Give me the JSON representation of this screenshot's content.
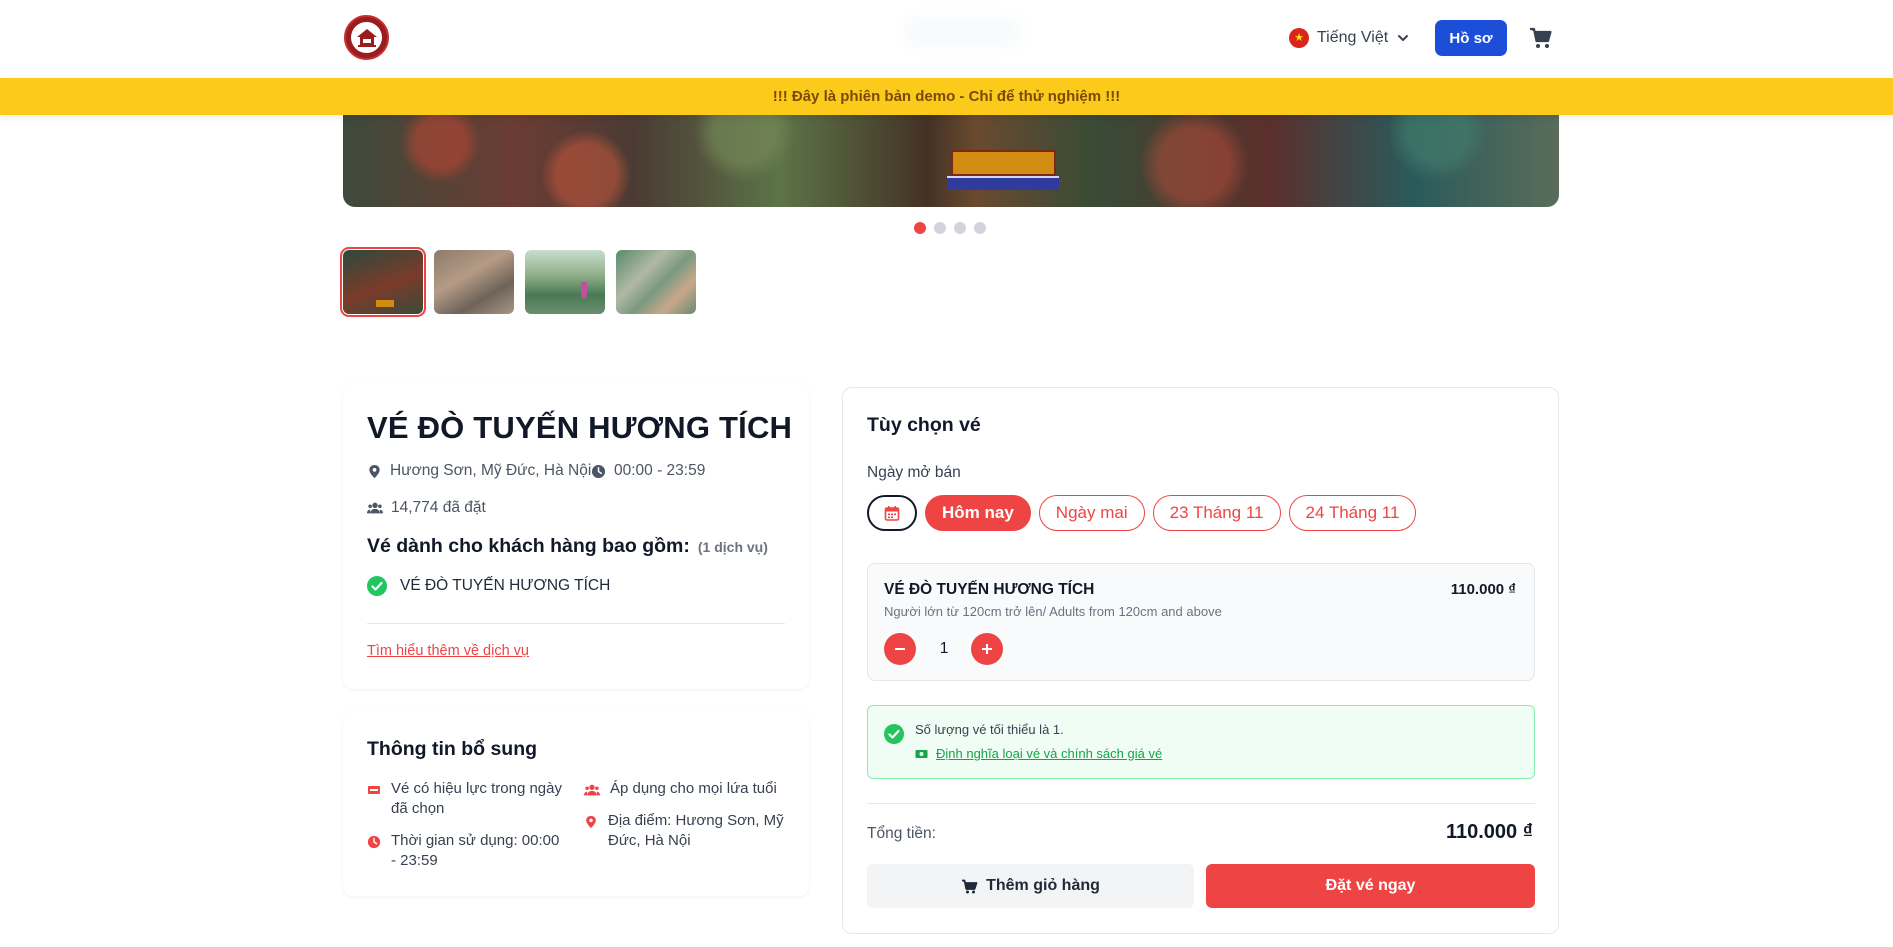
{
  "header": {
    "language_label": "Tiếng Việt",
    "profile_label": "Hồ sơ"
  },
  "banner": {
    "text": "!!! Đây là phiên bản demo - Chỉ để thử nghiệm !!!"
  },
  "carousel": {
    "slide_count": 4,
    "active_index": 0,
    "thumbnail_count": 4
  },
  "product": {
    "title": "VÉ ĐÒ TUYẾN HƯƠNG TÍCH",
    "location": "Hương Sơn, Mỹ Đức, Hà Nội",
    "hours": "00:00 - 23:59",
    "booked": "14,774 đã đặt",
    "includes_heading": "Vé dành cho khách hàng bao gồm:",
    "includes_count": "(1 dịch vụ)",
    "services": [
      "VÉ ĐÒ TUYẾN HƯƠNG TÍCH"
    ],
    "learn_more": "Tìm hiểu thêm về dịch vụ"
  },
  "extra_info": {
    "title": "Thông tin bổ sung",
    "validity": "Vé có hiệu lực trong ngày đã chọn",
    "ages": "Áp dụng cho mọi lứa tuổi",
    "usage_time": "Thời gian sử dụng: 00:00 - 23:59",
    "place": "Địa điểm: Hương Sơn, Mỹ Đức, Hà Nội"
  },
  "options": {
    "title": "Tùy chọn vé",
    "date_label": "Ngày mở bán",
    "dates": [
      "Hôm nay",
      "Ngày mai",
      "23 Tháng 11",
      "24 Tháng 11"
    ],
    "selected_date": "Hôm nay",
    "ticket": {
      "name": "VÉ ĐÒ TUYẾN HƯƠNG TÍCH",
      "price": "110.000 ₫",
      "description": "Người lớn từ 120cm trở lên/ Adults from 120cm and above",
      "quantity": "1"
    },
    "notice": "Số lượng vé tối thiểu là 1.",
    "policy_link": "Định nghĩa loại vé và chính sách giá vé",
    "total_label": "Tổng tiền:",
    "total_value": "110.000 ₫",
    "add_to_cart": "Thêm giỏ hàng",
    "book_now": "Đặt vé ngay"
  },
  "colors": {
    "accent_red": "#ef4444",
    "primary_blue": "#1d4ed8",
    "banner_yellow": "#fbca1a",
    "success_green": "#16a34a"
  },
  "icons": [
    "logo",
    "vietnam-flag-icon",
    "chevron-down-icon",
    "cart-icon",
    "map-pin-icon",
    "clock-icon",
    "users-icon",
    "check-circle-icon",
    "ticket-icon",
    "calendar-icon",
    "minus-icon",
    "plus-icon",
    "money-icon"
  ]
}
